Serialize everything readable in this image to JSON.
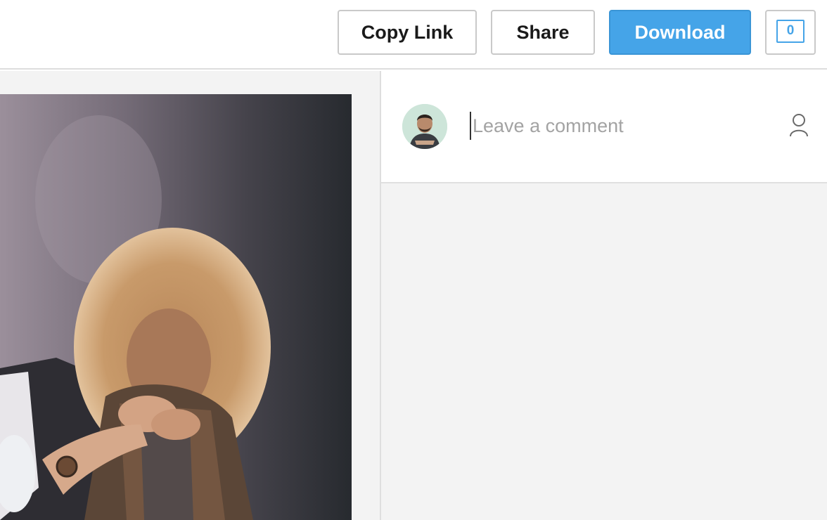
{
  "toolbar": {
    "copy_link_label": "Copy Link",
    "share_label": "Share",
    "download_label": "Download",
    "comment_count": "0",
    "accent_color": "#45a4e8"
  },
  "comments": {
    "placeholder": "Leave a comment",
    "avatar_icon": "user-avatar",
    "profile_icon": "person-outline-icon"
  },
  "image": {
    "subject_icon": "photo"
  }
}
